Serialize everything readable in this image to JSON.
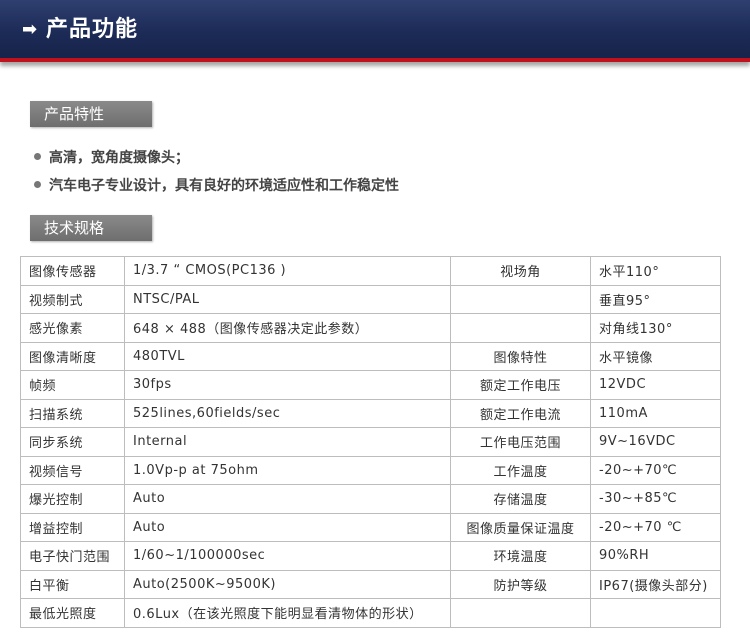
{
  "header": {
    "title": "产品功能"
  },
  "features_section": {
    "label": "产品特性"
  },
  "features": [
    "高清，宽角度摄像头；",
    "汽车电子专业设计，具有良好的环境适应性和工作稳定性"
  ],
  "specs_section": {
    "label": "技术规格"
  },
  "specs": [
    {
      "lk": "图像传感器",
      "lv": "1/3.7 “ CMOS(PC136 )",
      "rk": "视场角",
      "rv": "水平110°"
    },
    {
      "lk": "视频制式",
      "lv": "NTSC/PAL",
      "rk": "",
      "rv": "垂直95°"
    },
    {
      "lk": "感光像素",
      "lv": "648 × 488（图像传感器决定此参数）",
      "rk": "",
      "rv": "对角线130°"
    },
    {
      "lk": "图像清晰度",
      "lv": "480TVL",
      "rk": "图像特性",
      "rv": "水平镜像"
    },
    {
      "lk": "帧频",
      "lv": "30fps",
      "rk": "额定工作电压",
      "rv": "12VDC"
    },
    {
      "lk": "扫描系统",
      "lv": "525lines,60fields/sec",
      "rk": "额定工作电流",
      "rv": "110mA"
    },
    {
      "lk": "同步系统",
      "lv": "Internal",
      "rk": "工作电压范围",
      "rv": "9V~16VDC"
    },
    {
      "lk": "视频信号",
      "lv": "1.0Vp-p at 75ohm",
      "rk": "工作温度",
      "rv": "-20~+70℃"
    },
    {
      "lk": "爆光控制",
      "lv": "Auto",
      "rk": "存储温度",
      "rv": "-30~+85℃"
    },
    {
      "lk": "增益控制",
      "lv": "Auto",
      "rk": "图像质量保证温度",
      "rv": "-20~+70 ℃"
    },
    {
      "lk": "电子快门范围",
      "lv": "1/60~1/100000sec",
      "rk": "环境温度",
      "rv": "90%RH"
    },
    {
      "lk": "白平衡",
      "lv": "Auto(2500K~9500K)",
      "rk": "防护等级",
      "rv": "IP67(摄像头部分)"
    },
    {
      "lk": "最低光照度",
      "lv": "0.6Lux（在该光照度下能明显看清物体的形状）",
      "rk": "",
      "rv": ""
    }
  ]
}
